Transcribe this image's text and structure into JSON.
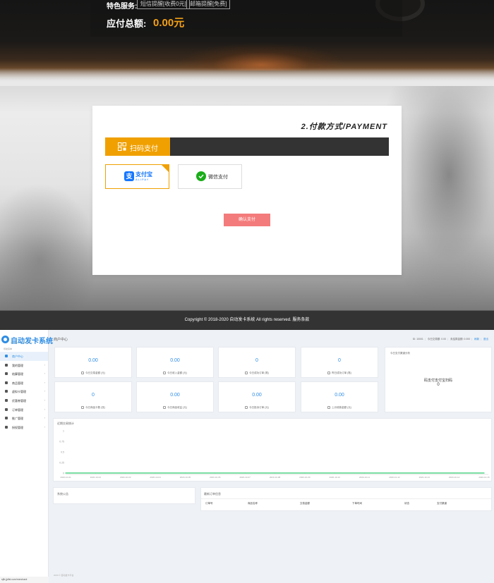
{
  "checkout": {
    "service_label": "特色服务:",
    "service_options": [
      "短信提醒[收费0元]",
      "邮箱提醒[免费]"
    ],
    "total_label": "应付总额:",
    "total_value": "0.00元",
    "card_title": "2.付款方式/PAYMENT",
    "pay_tab_label": "扫码支付",
    "methods": [
      {
        "name": "支付宝",
        "sub": "ALIPAY",
        "selected": true
      },
      {
        "name": "微信支付",
        "selected": false
      }
    ],
    "confirm_button": "确认支付",
    "footer": "Copyright © 2018-2020 自动发卡系统 All rights reserved. 服务条款"
  },
  "dashboard": {
    "logo_text": "自动发卡系统",
    "logo_sub": "AUTO SHIPPING CARD SYSTEM",
    "nav_section": "导航菜单",
    "nav_items": [
      {
        "label": "商户中心",
        "active": true,
        "arrow": false
      },
      {
        "label": "我的管理",
        "active": false,
        "arrow": true
      },
      {
        "label": "结算管理",
        "active": false,
        "arrow": true
      },
      {
        "label": "商品管理",
        "active": false,
        "arrow": true
      },
      {
        "label": "虚拟卡管理",
        "active": false,
        "arrow": true
      },
      {
        "label": "优惠券管理",
        "active": false,
        "arrow": true
      },
      {
        "label": "订单管理",
        "active": false,
        "arrow": true
      },
      {
        "label": "推广管理",
        "active": false,
        "arrow": true
      },
      {
        "label": "授权管理",
        "active": false,
        "arrow": true
      }
    ],
    "sidebar_url": "sjfk.jjdfsl.com/merchant",
    "title": "商户中心",
    "top_stats": {
      "id": "ID: 10001",
      "today": "今日交易额: 0.00",
      "balance": "未结算金额: 0.000",
      "refresh": "刷新",
      "logout": "退出"
    },
    "stat_cards": [
      {
        "value": "0.00",
        "label": "今日交易金额 (元)"
      },
      {
        "value": "0.00",
        "label": "今日收入金额 (元)"
      },
      {
        "value": "0",
        "label": "今日成功订单 (笔)"
      },
      {
        "value": "0",
        "label": "昨日成功订单 (笔)"
      },
      {
        "value": "0",
        "label": "今日商品卡数 (张)"
      },
      {
        "value": "0.00",
        "label": "今日商品收益 (元)"
      },
      {
        "value": "0.00",
        "label": "今日投诉订单 (元)"
      },
      {
        "value": "0.00",
        "label": "上月收款金额 (元)"
      }
    ],
    "today_card": {
      "title": "今日支付渠道分析",
      "label": "码支付支付宝扫码",
      "value": "0"
    },
    "notice_title": "系统公告",
    "orders_title": "最新订单信息",
    "orders_columns": [
      "订单号",
      "商品名称",
      "交易金额",
      "下单时间",
      "状态",
      "支付渠道"
    ],
    "footer": "2020 © 自动发卡平台"
  },
  "chart_data": {
    "type": "line",
    "title": "近期交易统计",
    "x": [
      "2020-10-01",
      "2020-10-02",
      "2020-10-03",
      "2020-10-04",
      "2020-10-05",
      "2020-10-06",
      "2020-10-07",
      "2020-10-08",
      "2020-10-09",
      "2020-10-10",
      "2020-10-11",
      "2020-10-12",
      "2020-10-13",
      "2020-10-14",
      "2020-10-15"
    ],
    "series": [
      {
        "values": [
          0,
          0,
          0,
          0,
          0,
          0,
          0,
          0,
          0,
          0,
          0,
          0,
          0,
          0,
          0
        ],
        "color": "#2ecc71"
      }
    ],
    "y_ticks": [
      "1",
      "0.75",
      "0.5",
      "0.25",
      "0"
    ],
    "ylim": [
      0,
      1
    ],
    "grid": false
  }
}
